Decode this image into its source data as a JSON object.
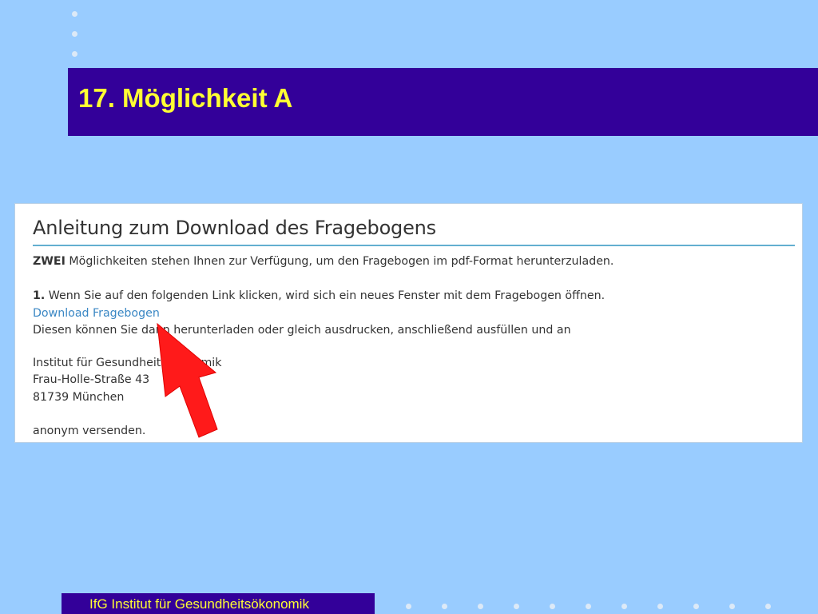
{
  "slide": {
    "title": "17. Möglichkeit A",
    "footer": "IfG Institut für Gesundheitsökonomik"
  },
  "screenshot": {
    "heading": "Anleitung zum Download des Fragebogens",
    "intro_bold": "ZWEI",
    "intro_rest": " Möglichkeiten stehen Ihnen zur Verfügung, um den Fragebogen im pdf-Format herunterzuladen.",
    "step1_bold": "1.",
    "step1_rest": " Wenn Sie auf den folgenden Link klicken, wird sich ein neues Fenster mit dem Fragebogen öffnen.",
    "download_link": "Download Fragebogen",
    "step1_after": "Diesen können Sie dann herunterladen oder gleich ausdrucken, anschließend ausfüllen und an",
    "address_line1": "Institut für Gesundheitsökonomik",
    "address_line2": "Frau-Holle-Straße 43",
    "address_line3": "81739 München",
    "closing": "anonym versenden."
  },
  "colors": {
    "background": "#99CCFF",
    "title_bar": "#330099",
    "title_text": "#FFFF33",
    "link": "#3A87C4",
    "arrow": "#FF1A1A"
  },
  "icons": {
    "pointer": "arrow-up-left-icon",
    "bullets": "bullet-dot-icon"
  }
}
